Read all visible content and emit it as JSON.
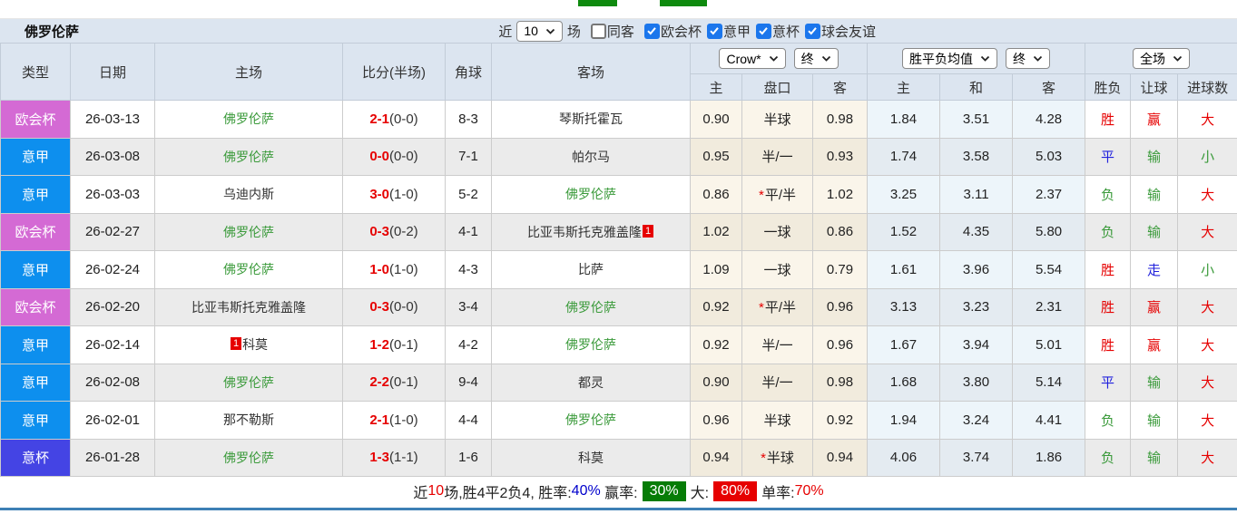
{
  "page": {
    "title": "佛罗伦萨"
  },
  "filters": {
    "recent_label": "近",
    "recent_value": "10",
    "games_label": "场",
    "same_opponent": {
      "label": "同客",
      "checked": false
    },
    "competitions": [
      {
        "label": "欧会杯",
        "checked": true
      },
      {
        "label": "意甲",
        "checked": true
      },
      {
        "label": "意杯",
        "checked": true
      },
      {
        "label": "球会友谊",
        "checked": true
      }
    ]
  },
  "table": {
    "main_headers": [
      "类型",
      "日期",
      "主场",
      "比分(半场)",
      "角球",
      "客场"
    ],
    "selects": {
      "odds_source": "Crow*",
      "odds_time": "终",
      "avg_source": "胜平负均值",
      "avg_time": "终",
      "scope": "全场"
    },
    "sub_headers": [
      "主",
      "盘口",
      "客",
      "主",
      "和",
      "客",
      "胜负",
      "让球",
      "进球数"
    ]
  },
  "colors": {
    "type_colors": {
      "欧会杯": "#d46ad4",
      "意甲": "#0d8fee",
      "意杯": "#4444e4"
    },
    "self_team": "#3a9a3a",
    "score_red": "#e60000",
    "red_card_badge": "#e60000",
    "result_red": "#e60000",
    "result_blue": "#2222dd",
    "result_green": "#3a9a3a",
    "summary_win_box": "#067c06",
    "summary_big_box": "#e60000",
    "accent_line": "#3d80b5",
    "green_tab": "#0e8a0e",
    "header_bg": "#dce5f0"
  },
  "rows": [
    {
      "type": "欧会杯",
      "date": "26-03-13",
      "home": {
        "name": "佛罗伦萨",
        "self": true
      },
      "score_ft": "2-1",
      "score_ht": "(0-0)",
      "corners": "8-3",
      "away": {
        "name": "琴斯托霍瓦",
        "self": false
      },
      "odds_home": "0.90",
      "handicap": "半球",
      "handicap_star": false,
      "odds_away": "0.98",
      "avg_home": "1.84",
      "avg_draw": "3.51",
      "avg_away": "4.28",
      "result": {
        "text": "胜",
        "color": "red"
      },
      "handicap_result": {
        "text": "赢",
        "color": "red"
      },
      "goals": {
        "text": "大",
        "color": "red"
      }
    },
    {
      "type": "意甲",
      "date": "26-03-08",
      "home": {
        "name": "佛罗伦萨",
        "self": true
      },
      "score_ft": "0-0",
      "score_ht": "(0-0)",
      "corners": "7-1",
      "away": {
        "name": "帕尔马",
        "self": false
      },
      "odds_home": "0.95",
      "handicap": "半/一",
      "handicap_star": false,
      "odds_away": "0.93",
      "avg_home": "1.74",
      "avg_draw": "3.58",
      "avg_away": "5.03",
      "result": {
        "text": "平",
        "color": "blue"
      },
      "handicap_result": {
        "text": "输",
        "color": "green"
      },
      "goals": {
        "text": "小",
        "color": "green"
      }
    },
    {
      "type": "意甲",
      "date": "26-03-03",
      "home": {
        "name": "乌迪内斯",
        "self": false
      },
      "score_ft": "3-0",
      "score_ht": "(1-0)",
      "corners": "5-2",
      "away": {
        "name": "佛罗伦萨",
        "self": true
      },
      "odds_home": "0.86",
      "handicap": "平/半",
      "handicap_star": true,
      "odds_away": "1.02",
      "avg_home": "3.25",
      "avg_draw": "3.11",
      "avg_away": "2.37",
      "result": {
        "text": "负",
        "color": "green"
      },
      "handicap_result": {
        "text": "输",
        "color": "green"
      },
      "goals": {
        "text": "大",
        "color": "red"
      }
    },
    {
      "type": "欧会杯",
      "date": "26-02-27",
      "home": {
        "name": "佛罗伦萨",
        "self": true
      },
      "score_ft": "0-3",
      "score_ht": "(0-2)",
      "corners": "4-1",
      "away": {
        "name": "比亚韦斯托克雅盖隆",
        "self": false,
        "badge": "1",
        "badge_pos": "after"
      },
      "odds_home": "1.02",
      "handicap": "一球",
      "handicap_star": false,
      "odds_away": "0.86",
      "avg_home": "1.52",
      "avg_draw": "4.35",
      "avg_away": "5.80",
      "result": {
        "text": "负",
        "color": "green"
      },
      "handicap_result": {
        "text": "输",
        "color": "green"
      },
      "goals": {
        "text": "大",
        "color": "red"
      }
    },
    {
      "type": "意甲",
      "date": "26-02-24",
      "home": {
        "name": "佛罗伦萨",
        "self": true
      },
      "score_ft": "1-0",
      "score_ht": "(1-0)",
      "corners": "4-3",
      "away": {
        "name": "比萨",
        "self": false
      },
      "odds_home": "1.09",
      "handicap": "一球",
      "handicap_star": false,
      "odds_away": "0.79",
      "avg_home": "1.61",
      "avg_draw": "3.96",
      "avg_away": "5.54",
      "result": {
        "text": "胜",
        "color": "red"
      },
      "handicap_result": {
        "text": "走",
        "color": "blue"
      },
      "goals": {
        "text": "小",
        "color": "green"
      }
    },
    {
      "type": "欧会杯",
      "date": "26-02-20",
      "home": {
        "name": "比亚韦斯托克雅盖隆",
        "self": false
      },
      "score_ft": "0-3",
      "score_ht": "(0-0)",
      "corners": "3-4",
      "away": {
        "name": "佛罗伦萨",
        "self": true
      },
      "odds_home": "0.92",
      "handicap": "平/半",
      "handicap_star": true,
      "odds_away": "0.96",
      "avg_home": "3.13",
      "avg_draw": "3.23",
      "avg_away": "2.31",
      "result": {
        "text": "胜",
        "color": "red"
      },
      "handicap_result": {
        "text": "赢",
        "color": "red"
      },
      "goals": {
        "text": "大",
        "color": "red"
      }
    },
    {
      "type": "意甲",
      "date": "26-02-14",
      "home": {
        "name": "科莫",
        "self": false,
        "badge": "1",
        "badge_pos": "before"
      },
      "score_ft": "1-2",
      "score_ht": "(0-1)",
      "corners": "4-2",
      "away": {
        "name": "佛罗伦萨",
        "self": true
      },
      "odds_home": "0.92",
      "handicap": "半/一",
      "handicap_star": false,
      "odds_away": "0.96",
      "avg_home": "1.67",
      "avg_draw": "3.94",
      "avg_away": "5.01",
      "result": {
        "text": "胜",
        "color": "red"
      },
      "handicap_result": {
        "text": "赢",
        "color": "red"
      },
      "goals": {
        "text": "大",
        "color": "red"
      }
    },
    {
      "type": "意甲",
      "date": "26-02-08",
      "home": {
        "name": "佛罗伦萨",
        "self": true
      },
      "score_ft": "2-2",
      "score_ht": "(0-1)",
      "corners": "9-4",
      "away": {
        "name": "都灵",
        "self": false
      },
      "odds_home": "0.90",
      "handicap": "半/一",
      "handicap_star": false,
      "odds_away": "0.98",
      "avg_home": "1.68",
      "avg_draw": "3.80",
      "avg_away": "5.14",
      "result": {
        "text": "平",
        "color": "blue"
      },
      "handicap_result": {
        "text": "输",
        "color": "green"
      },
      "goals": {
        "text": "大",
        "color": "red"
      }
    },
    {
      "type": "意甲",
      "date": "26-02-01",
      "home": {
        "name": "那不勒斯",
        "self": false
      },
      "score_ft": "2-1",
      "score_ht": "(1-0)",
      "corners": "4-4",
      "away": {
        "name": "佛罗伦萨",
        "self": true
      },
      "odds_home": "0.96",
      "handicap": "半球",
      "handicap_star": false,
      "odds_away": "0.92",
      "avg_home": "1.94",
      "avg_draw": "3.24",
      "avg_away": "4.41",
      "result": {
        "text": "负",
        "color": "green"
      },
      "handicap_result": {
        "text": "输",
        "color": "green"
      },
      "goals": {
        "text": "大",
        "color": "red"
      }
    },
    {
      "type": "意杯",
      "date": "26-01-28",
      "home": {
        "name": "佛罗伦萨",
        "self": true
      },
      "score_ft": "1-3",
      "score_ht": "(1-1)",
      "corners": "1-6",
      "away": {
        "name": "科莫",
        "self": false
      },
      "odds_home": "0.94",
      "handicap": "半球",
      "handicap_star": true,
      "odds_away": "0.94",
      "avg_home": "4.06",
      "avg_draw": "3.74",
      "avg_away": "1.86",
      "result": {
        "text": "负",
        "color": "green"
      },
      "handicap_result": {
        "text": "输",
        "color": "green"
      },
      "goals": {
        "text": "大",
        "color": "red"
      }
    }
  ],
  "summary": {
    "near_label": "近",
    "count": "10",
    "middle": "场,胜4平2负4, 胜率:",
    "win_rate": "40%",
    "handicap_label": " 赢率:",
    "handicap_rate": "30%",
    "big_label": "大:",
    "big_rate": "80%",
    "single_label": "单率:",
    "single_rate": "70%"
  }
}
